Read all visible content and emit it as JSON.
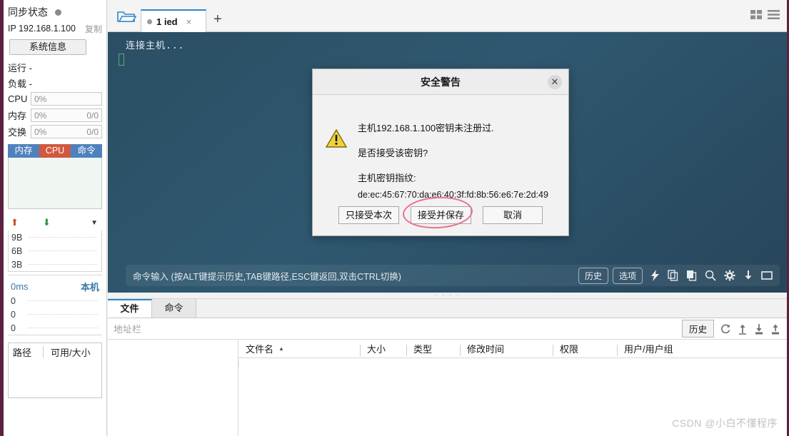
{
  "sidebar": {
    "sync_status_label": "同步状态",
    "ip_label": "IP 192.168.1.100",
    "copy_label": "复制",
    "sysinfo_button": "系统信息",
    "runtime_label": "运行 -",
    "load_label": "负载 -",
    "stats": [
      {
        "key": "CPU",
        "value": "0%",
        "extra": ""
      },
      {
        "key": "内存",
        "value": "0%",
        "extra": "0/0"
      },
      {
        "key": "交换",
        "value": "0%",
        "extra": "0/0"
      }
    ],
    "graph_tabs": [
      {
        "label": "内存",
        "active": false
      },
      {
        "label": "CPU",
        "active": true
      },
      {
        "label": "命令",
        "active": false
      }
    ],
    "net_up_icon": "arrow-up-icon",
    "net_down_icon": "arrow-down-icon",
    "net_caret_icon": "caret-down-icon",
    "net_axis": [
      "9B",
      "6B",
      "3B"
    ],
    "latency_value": "0ms",
    "latency_host": "本机",
    "latency_axis": [
      "0",
      "0",
      "0"
    ],
    "fs_headers": [
      "路径",
      "可用/大小"
    ]
  },
  "tabbar": {
    "folder_icon": "folder-icon",
    "tab_title": "1 ied",
    "tab_close": "×",
    "add_tab": "+",
    "view_grid_icon": "grid-view-icon",
    "view_list_icon": "list-view-icon"
  },
  "terminal": {
    "output_line": "连接主机...",
    "command_placeholder": "命令输入 (按ALT键提示历史,TAB键路径,ESC键返回,双击CTRL切换)",
    "history_button": "历史",
    "options_button": "选项",
    "icons": [
      "lightning-icon",
      "copy-icon",
      "paste-icon",
      "search-icon",
      "gear-icon",
      "download-icon",
      "window-icon"
    ]
  },
  "bottom": {
    "tabs": [
      {
        "label": "文件",
        "active": true
      },
      {
        "label": "命令",
        "active": false
      }
    ],
    "address_placeholder": "地址栏",
    "history_button": "历史",
    "toolbar_icons": [
      "refresh-icon",
      "up-icon",
      "download-icon",
      "upload-icon"
    ],
    "file_columns": [
      "文件名",
      "大小",
      "类型",
      "修改时间",
      "权限",
      "用户/用户组"
    ],
    "sort_caret": "▲"
  },
  "dialog": {
    "title": "安全警告",
    "close_icon": "close-icon",
    "warning_icon": "warning-triangle-icon",
    "line1": "主机192.168.1.100密钥未注册过.",
    "line2": "是否接受该密钥?",
    "line3": "主机密钥指纹:",
    "fingerprint": "de:ec:45:67:70:da:e6:40:3f:fd:8b:56:e6:7e:2d:49",
    "buttons": [
      {
        "label": "只接受本次"
      },
      {
        "label": "接受并保存"
      },
      {
        "label": "取消"
      }
    ]
  },
  "watermark": "CSDN @小白不懂程序",
  "colors": {
    "accent_blue": "#2f87c9",
    "tab_blue": "#4f81bd",
    "tab_orange": "#d1593f",
    "terminal_bg": "#2f5870",
    "annotation_red": "#e8708f",
    "edge_maroon": "#5b2240"
  }
}
